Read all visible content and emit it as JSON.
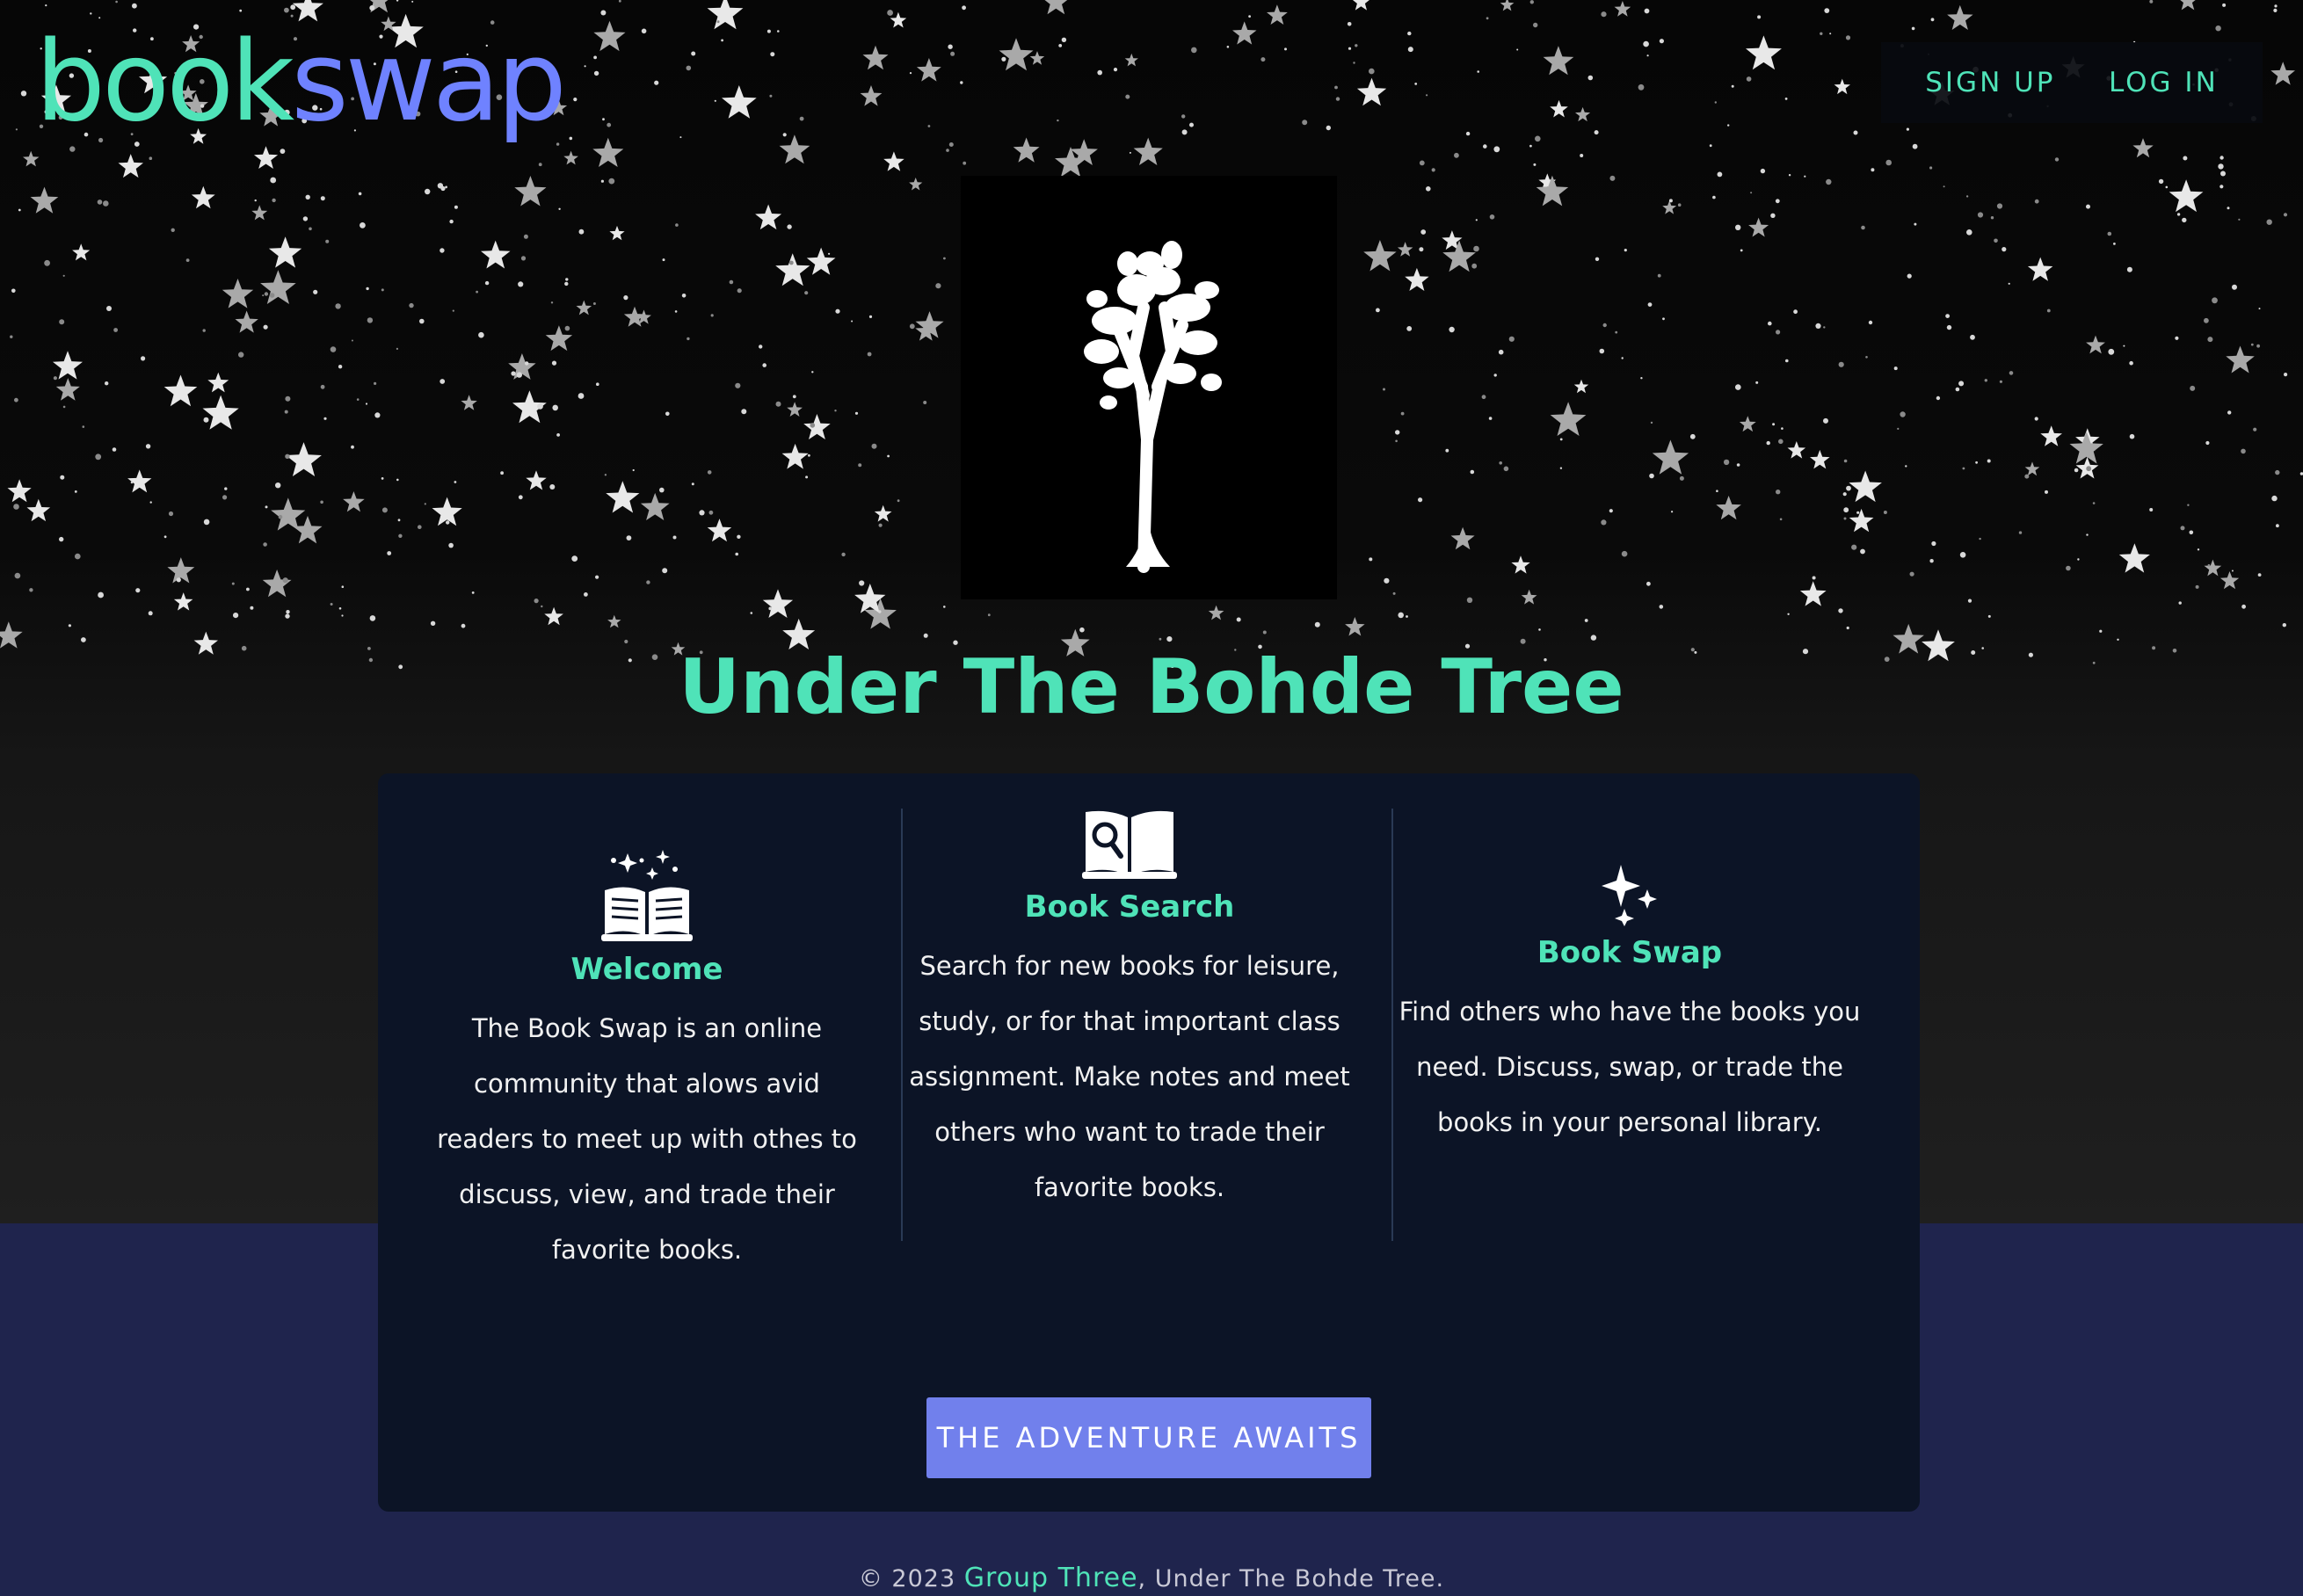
{
  "brand": {
    "part1": "book",
    "part2": "swap",
    "color1": "#4fe3b8",
    "color2": "#6f82ff"
  },
  "nav": {
    "signup": "SIGN UP",
    "login": "LOG IN"
  },
  "hero": {
    "logo_icon": "tree-icon",
    "title": "Under The Bohde Tree"
  },
  "features": [
    {
      "icon": "magic-book-icon",
      "title": "Welcome",
      "text": "The Book Swap is an online community that alows avid readers to meet up with othes to discuss, view, and trade their favorite books."
    },
    {
      "icon": "book-search-icon",
      "title": "Book Search",
      "text": "Search for new books for leisure, study, or for that important class assignment. Make notes and meet others who want to trade their favorite books."
    },
    {
      "icon": "sparkles-icon",
      "title": "Book Swap",
      "text": "Find others who have the books you need. Discuss, swap, or trade the books in your personal library."
    }
  ],
  "cta": {
    "label": "THE ADVENTURE AWAITS"
  },
  "footer": {
    "prefix": "© 2023 ",
    "link": "Group Three",
    "suffix": ", Under The Bohde Tree."
  },
  "colors": {
    "accent": "#4fe3b8",
    "button": "#7180ec",
    "card": "#0c1426",
    "band": "#1f244d"
  }
}
